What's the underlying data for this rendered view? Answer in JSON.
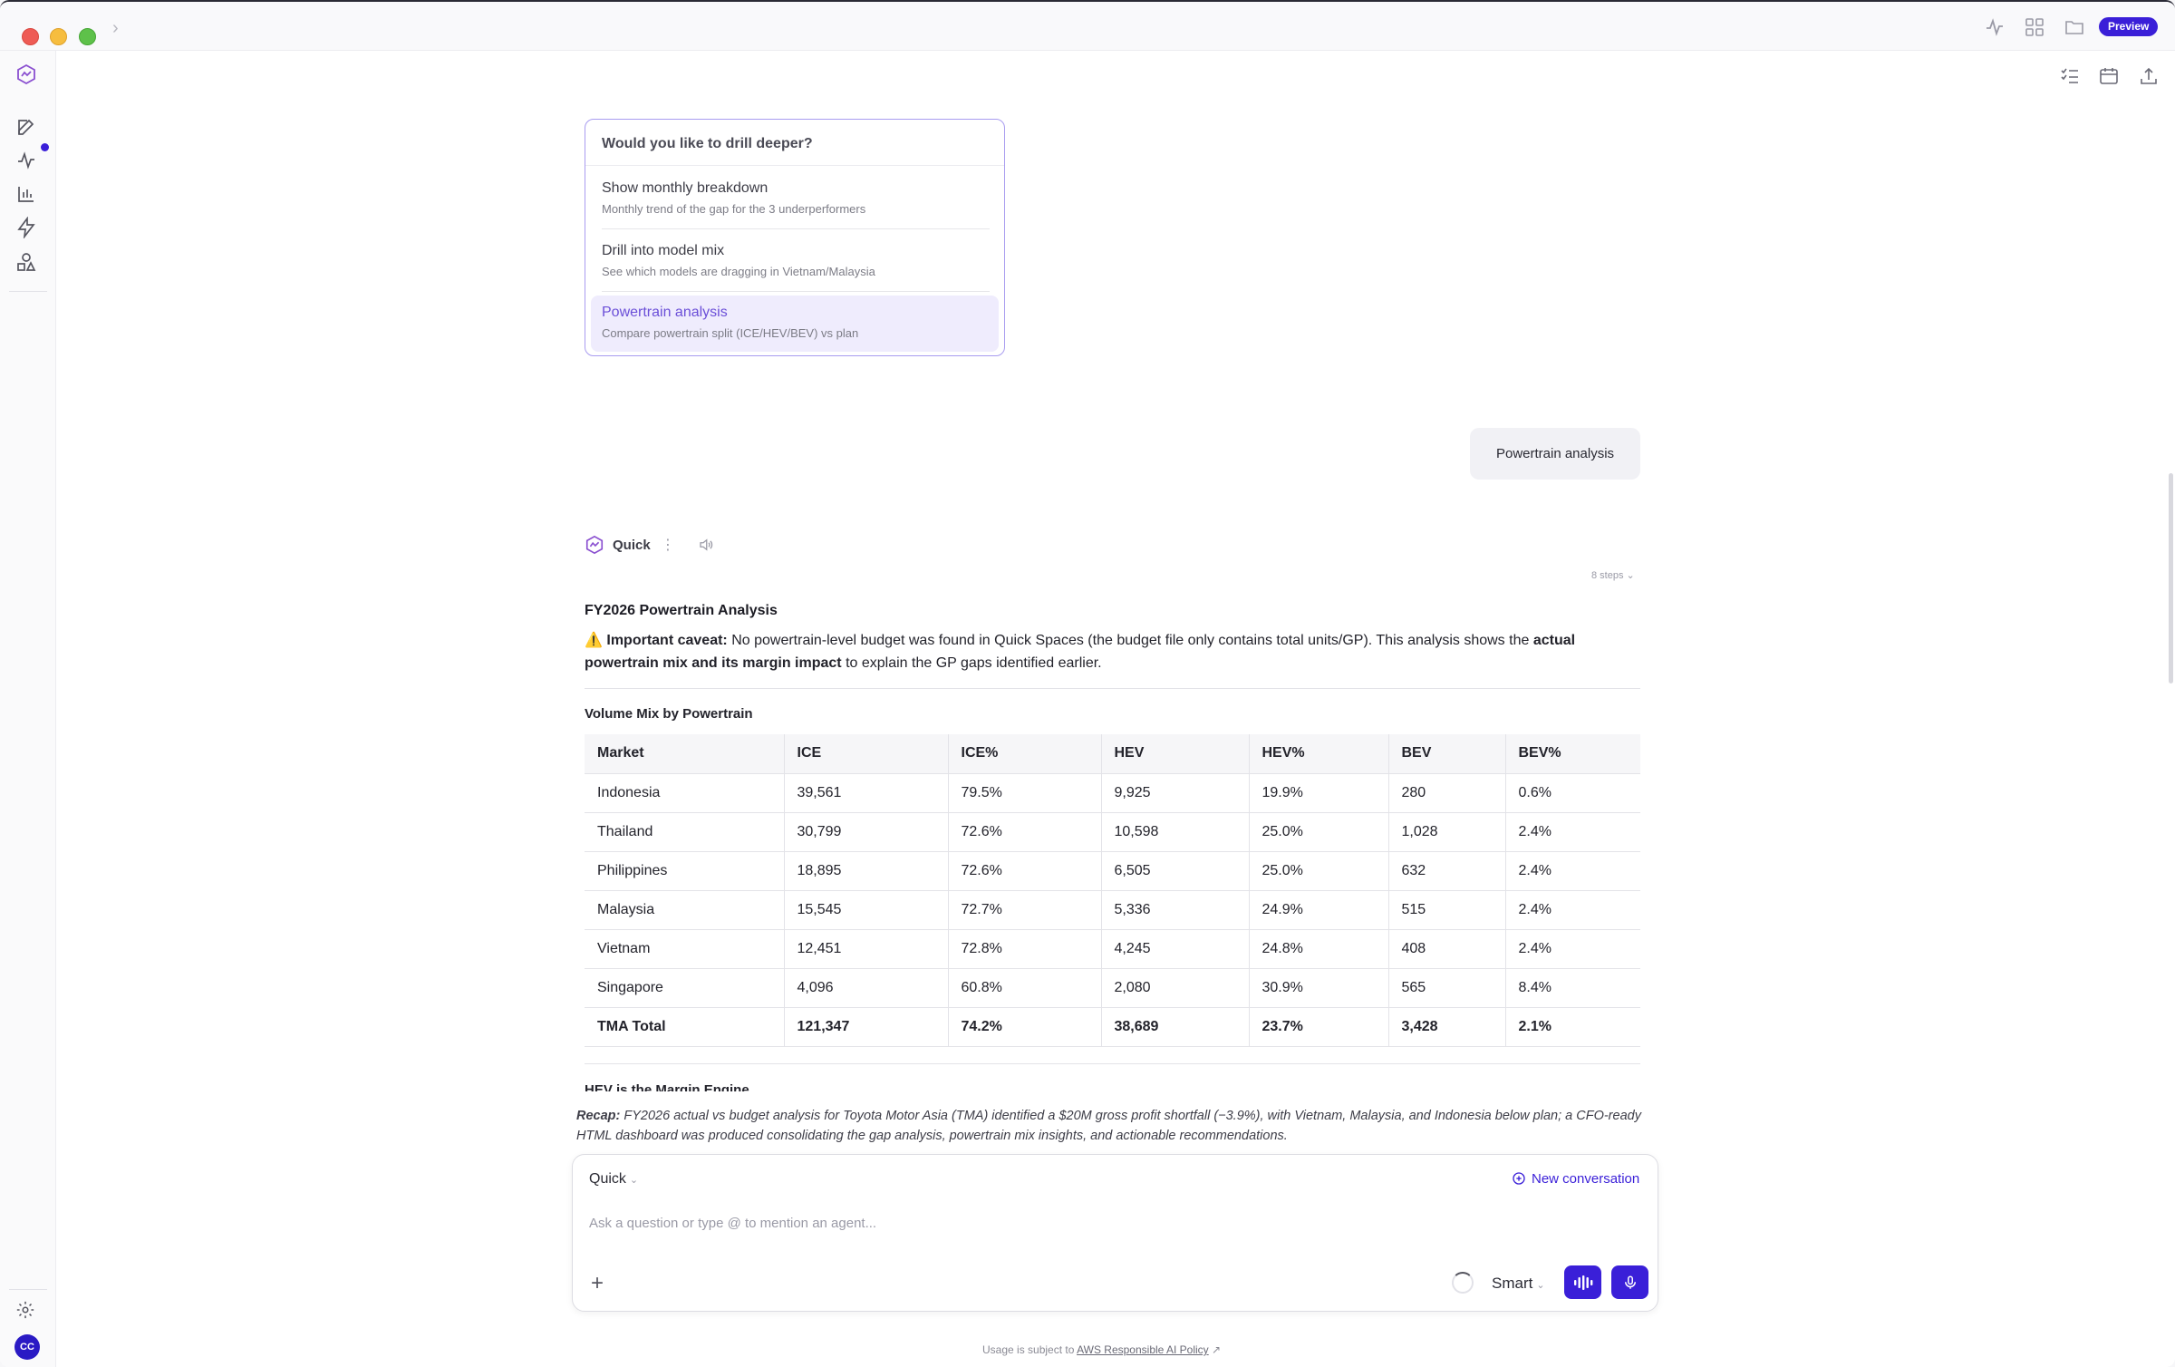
{
  "titlebar": {
    "preview_badge": "Preview",
    "icons": [
      "activity-icon",
      "grid-icon",
      "folder-icon"
    ]
  },
  "rail": {
    "icons": [
      "app-logo-icon",
      "compose-icon",
      "activity-icon",
      "bar-chart-icon",
      "lightning-icon",
      "shapes-icon",
      "settings-icon"
    ],
    "avatar_initials": "CC"
  },
  "toolbar": {
    "icons": [
      "checklist-icon",
      "calendar-icon",
      "upload-icon"
    ]
  },
  "drill": {
    "heading": "Would you like to drill deeper?",
    "items": [
      {
        "title": "Show monthly breakdown",
        "subtitle": "Monthly trend of the gap for the 3 underperformers"
      },
      {
        "title": "Drill into model mix",
        "subtitle": "See which models are dragging in Vietnam/Malaysia"
      },
      {
        "title": "Powertrain analysis",
        "subtitle": "Compare powertrain split (ICE/HEV/BEV) vs plan"
      }
    ]
  },
  "user_message": "Powertrain analysis",
  "assistant": {
    "name": "Quick",
    "steps_label": "8 steps",
    "title": "FY2026 Powertrain Analysis",
    "caveat_prefix": "⚠️ ",
    "caveat_label": "Important caveat:",
    "caveat_text": " No powertrain-level budget was found in Quick Spaces (the budget file only contains total units/GP). This analysis shows the ",
    "caveat_bold": "actual powertrain mix and its margin impact",
    "caveat_tail": " to explain the GP gaps identified earlier.",
    "table_title": "Volume Mix by Powertrain",
    "next_heading": "HEV is the Margin Engine"
  },
  "table": {
    "headers": [
      "Market",
      "ICE",
      "ICE%",
      "HEV",
      "HEV%",
      "BEV",
      "BEV%"
    ],
    "rows": [
      [
        "Indonesia",
        "39,561",
        "79.5%",
        "9,925",
        "19.9%",
        "280",
        "0.6%"
      ],
      [
        "Thailand",
        "30,799",
        "72.6%",
        "10,598",
        "25.0%",
        "1,028",
        "2.4%"
      ],
      [
        "Philippines",
        "18,895",
        "72.6%",
        "6,505",
        "25.0%",
        "632",
        "2.4%"
      ],
      [
        "Malaysia",
        "15,545",
        "72.7%",
        "5,336",
        "24.9%",
        "515",
        "2.4%"
      ],
      [
        "Vietnam",
        "12,451",
        "72.8%",
        "4,245",
        "24.8%",
        "408",
        "2.4%"
      ],
      [
        "Singapore",
        "4,096",
        "60.8%",
        "2,080",
        "30.9%",
        "565",
        "8.4%"
      ]
    ],
    "total": [
      "TMA Total",
      "121,347",
      "74.2%",
      "38,689",
      "23.7%",
      "3,428",
      "2.1%"
    ]
  },
  "recap": {
    "label": "Recap:",
    "text": " FY2026 actual vs budget analysis for Toyota Motor Asia (TMA) identified a $20M gross profit shortfall (−3.9%), with Vietnam, Malaysia, and Indonesia below plan; a CFO-ready HTML dashboard was produced consolidating the gap analysis, powertrain mix insights, and actionable recommendations."
  },
  "composer": {
    "agent": "Quick",
    "new_conversation": "New conversation",
    "placeholder": "Ask a question or type @ to mention an agent...",
    "mode": "Smart"
  },
  "footer": {
    "prefix": "Usage is subject to ",
    "link": "AWS Responsible AI Policy"
  },
  "colors": {
    "accent": "#3a1fd8",
    "drill_active_bg": "#efecfd",
    "drill_active_text": "#6b4fd8"
  }
}
